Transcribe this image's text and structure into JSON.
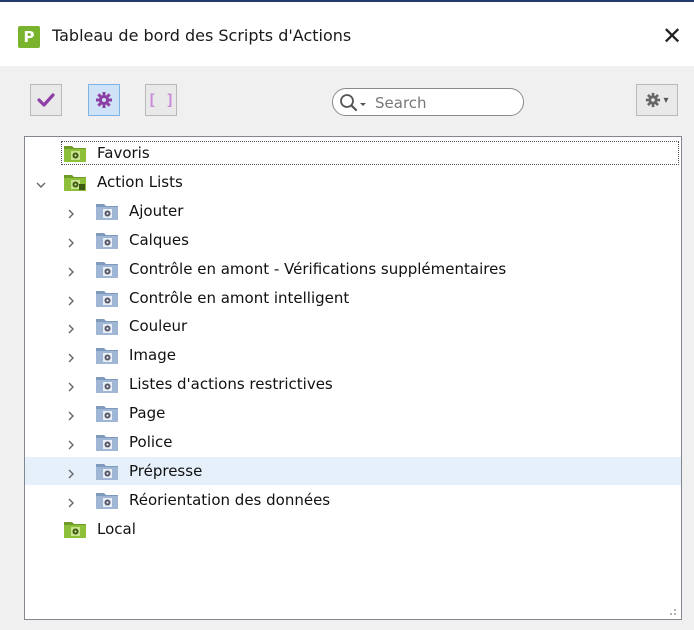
{
  "window": {
    "title": "Tableau de bord des Scripts d'Actions",
    "app_icon_glyph": "P",
    "close_glyph": "✕"
  },
  "toolbar": {
    "check_icon": "check-icon",
    "gear_icon": "gear-icon",
    "bracket_glyph": "[ ]",
    "search_placeholder": "Search",
    "settings_caret": "▾"
  },
  "tree": {
    "items": [
      {
        "label": "Favoris",
        "level": 0,
        "chevron": "none",
        "folder": "green",
        "focused": true
      },
      {
        "label": "Action Lists",
        "level": 0,
        "chevron": "down",
        "folder": "green-multi"
      },
      {
        "label": "Ajouter",
        "level": 1,
        "chevron": "right",
        "folder": "blue"
      },
      {
        "label": "Calques",
        "level": 1,
        "chevron": "right",
        "folder": "blue"
      },
      {
        "label": "Contrôle en amont - Vérifications supplémentaires",
        "level": 1,
        "chevron": "right",
        "folder": "blue"
      },
      {
        "label": "Contrôle en amont intelligent",
        "level": 1,
        "chevron": "right",
        "folder": "blue"
      },
      {
        "label": "Couleur",
        "level": 1,
        "chevron": "right",
        "folder": "blue"
      },
      {
        "label": "Image",
        "level": 1,
        "chevron": "right",
        "folder": "blue"
      },
      {
        "label": "Listes d'actions restrictives",
        "level": 1,
        "chevron": "right",
        "folder": "blue"
      },
      {
        "label": "Page",
        "level": 1,
        "chevron": "right",
        "folder": "blue"
      },
      {
        "label": "Police",
        "level": 1,
        "chevron": "right",
        "folder": "blue"
      },
      {
        "label": "Prépresse",
        "level": 1,
        "chevron": "right",
        "folder": "blue",
        "selected": true
      },
      {
        "label": "Réorientation des données",
        "level": 1,
        "chevron": "right",
        "folder": "blue"
      },
      {
        "label": "Local",
        "level": 0,
        "chevron": "none",
        "folder": "green"
      }
    ]
  },
  "colors": {
    "accent_green": "#7ab32e",
    "check_purple": "#8e3fa6",
    "selection_blue": "#e5f0fb",
    "folder_blue": "#8aa9cc"
  }
}
